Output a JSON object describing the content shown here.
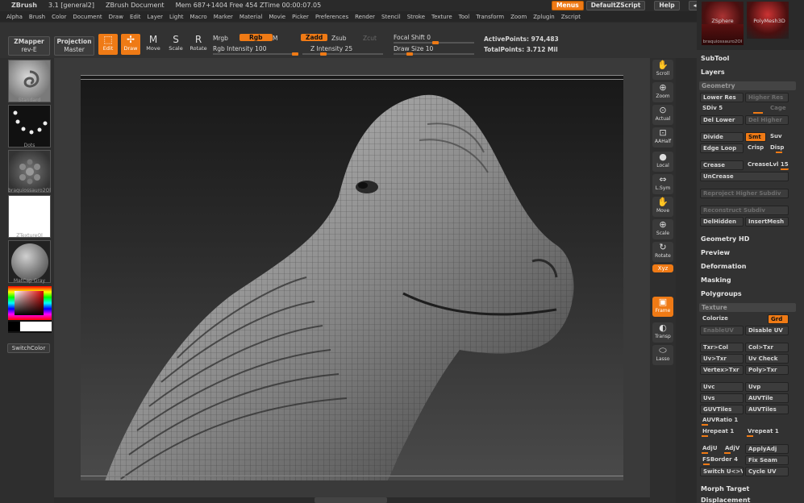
{
  "titlebar": {
    "app": "ZBrush",
    "version": "3.1 [general2]",
    "doc": "ZBrush Document",
    "mem": "Mem 687+1404  Free 454  ZTime 00:00:07.05"
  },
  "top_buttons": {
    "menus": "Menus",
    "default": "DefaultZScript",
    "help": "Help"
  },
  "menus": [
    "Alpha",
    "Brush",
    "Color",
    "Document",
    "Draw",
    "Edit",
    "Layer",
    "Light",
    "Macro",
    "Marker",
    "Material",
    "Movie",
    "Picker",
    "Preferences",
    "Render",
    "Stencil",
    "Stroke",
    "Texture",
    "Tool",
    "Transform",
    "Zoom",
    "Zplugin",
    "Zscript"
  ],
  "shelf": {
    "zmapper": "ZMapper",
    "zmapper_sub": "rev-E",
    "projection": "Projection",
    "projection_sub": "Master",
    "edit": "Edit",
    "draw": "Draw",
    "move": "Move",
    "scale": "Scale",
    "rotate": "Rotate",
    "mrgb": "Mrgb",
    "rgb": "Rgb",
    "m": "M",
    "rgb_intensity": "Rgb  Intensity 100",
    "zadd": "Zadd",
    "zsub": "Zsub",
    "zcut": "Zcut",
    "z_intensity": "Z Intensity 25",
    "focal_shift": "Focal Shift 0",
    "draw_size": "Draw  Size 10",
    "active_points": "ActivePoints: 974,483",
    "total_points": "TotalPoints: 3.712  Mil"
  },
  "left_tray": {
    "brush": "Standard",
    "stroke": "Dots",
    "alpha": "braquiossauro2Ol",
    "texture": "ZTextureOl",
    "material": "MatCap  Gray",
    "switch_color": "SwitchColor"
  },
  "right_nav": [
    "Scroll",
    "Zoom",
    "Actual",
    "AAHalf",
    "Local",
    "L.Sym",
    "Move",
    "Scale",
    "Rotate",
    "Frame",
    "Transp",
    "Lasso"
  ],
  "right_nav_xyz": "Xyz",
  "palette": {
    "thumbs": [
      "ZSphere",
      "PolyMesh3D",
      "braquiossauro2Ol"
    ],
    "subtool": "SubTool",
    "layers": "Layers",
    "geometry": "Geometry",
    "lower_res": "Lower Res",
    "higher_res": "Higher Res",
    "sdiv": "SDiv 5",
    "cage": "Cage",
    "del_lower": "Del Lower",
    "del_higher": "Del Higher",
    "divide": "Divide",
    "smt": "Smt",
    "suv": "Suv",
    "edge_loop": "Edge Loop",
    "crisp": "Crisp",
    "disp": "Disp",
    "crease": "Crease",
    "crease_lvl": "CreaseLvl 15",
    "uncrease": "UnCrease",
    "reproject": "Reproject Higher Subdiv",
    "reconstruct": "Reconstruct Subdiv",
    "del_hidden": "DelHidden",
    "insert_mesh": "InsertMesh",
    "geometry_hd": "Geometry HD",
    "preview": "Preview",
    "deformation": "Deformation",
    "masking": "Masking",
    "polygroups": "Polygroups",
    "texture": "Texture",
    "colorize": "Colorize",
    "grd": "Grd",
    "enable_uv": "EnableUV",
    "disable_uv": "Disable UV",
    "txr_col": "Txr>Col",
    "col_txr": "Col>Txr",
    "uv_txr": "Uv>Txr",
    "uv_check": "Uv Check",
    "vertex_txr": "Vertex>Txr",
    "poly_txr": "Poly>Txr",
    "uvc": "Uvc",
    "uvp": "Uvp",
    "uvs": "Uvs",
    "uvtile": "AUVTile",
    "guvtiles": "GUVTiles",
    "auvtiles": "AUVTiles",
    "auvratio": "AUVRatio 1",
    "hrepeat": "Hrepeat 1",
    "vrepeat": "Vrepeat 1",
    "adju": "AdjU",
    "adjv": "AdjV",
    "apply_adj": "ApplyAdj",
    "fsborder": "FSBorder 4",
    "fix_seam": "Fix Seam",
    "switch_uv": "Switch U<>V",
    "cycle_uv": "Cycle UV",
    "morph_target": "Morph Target",
    "displacement": "Displacement"
  },
  "colors": {
    "accent": "#ef7a15",
    "panel": "#323232",
    "canvas_top": "#181818",
    "canvas_bottom": "#4a4a4a"
  }
}
